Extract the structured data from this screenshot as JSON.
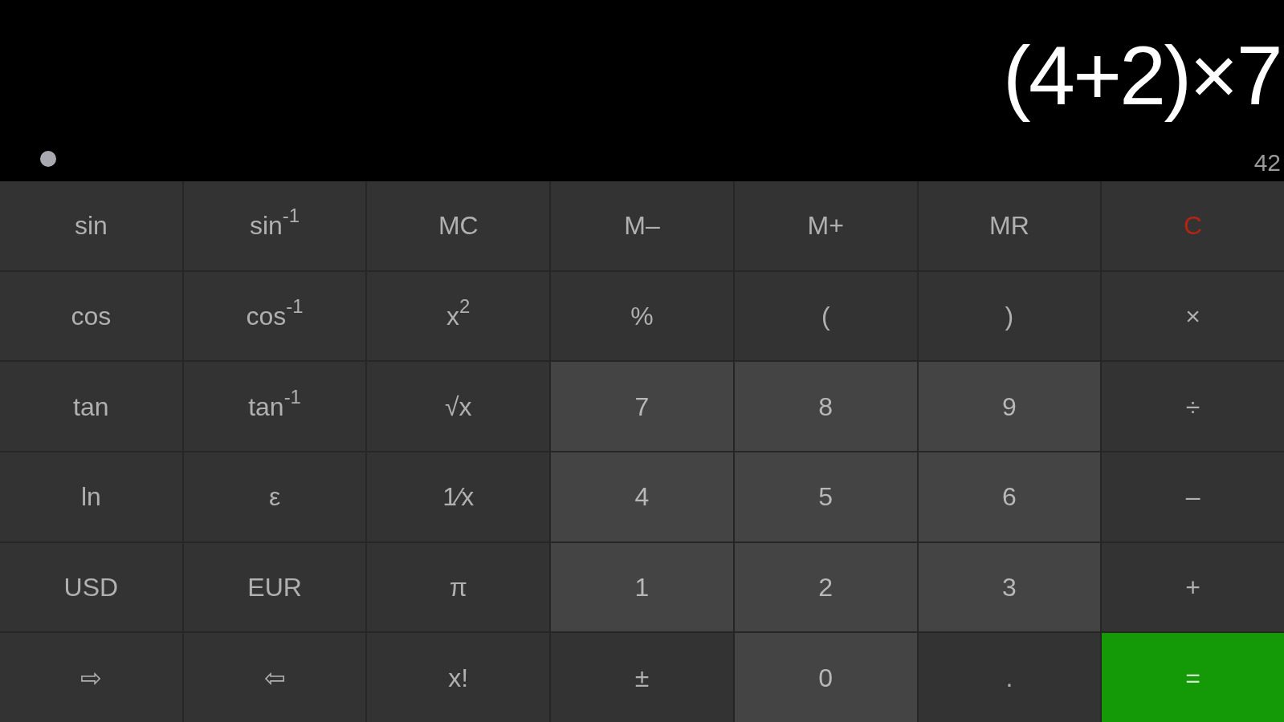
{
  "display": {
    "expression": "(4+2)×7",
    "result": "42"
  },
  "keys": [
    {
      "label": "sin",
      "kind": "func"
    },
    {
      "label": "sin$^{-1}$",
      "kind": "func"
    },
    {
      "label": "MC",
      "kind": "func"
    },
    {
      "label": "M–",
      "kind": "func"
    },
    {
      "label": "M+",
      "kind": "func"
    },
    {
      "label": "MR",
      "kind": "func"
    },
    {
      "label": "C",
      "kind": "clear"
    },
    {
      "label": "cos",
      "kind": "func"
    },
    {
      "label": "cos$^{-1}$",
      "kind": "func"
    },
    {
      "label": "x$^{2}$",
      "kind": "func"
    },
    {
      "label": "%",
      "kind": "func"
    },
    {
      "label": "(",
      "kind": "func"
    },
    {
      "label": ")",
      "kind": "func"
    },
    {
      "label": "×",
      "kind": "op"
    },
    {
      "label": "tan",
      "kind": "func"
    },
    {
      "label": "tan$^{-1}$",
      "kind": "func"
    },
    {
      "label": "√x",
      "kind": "func"
    },
    {
      "label": "7",
      "kind": "digit"
    },
    {
      "label": "8",
      "kind": "digit"
    },
    {
      "label": "9",
      "kind": "digit"
    },
    {
      "label": "÷",
      "kind": "op"
    },
    {
      "label": "ln",
      "kind": "func"
    },
    {
      "label": "ε",
      "kind": "func"
    },
    {
      "label": "1⁄x",
      "kind": "func"
    },
    {
      "label": "4",
      "kind": "digit"
    },
    {
      "label": "5",
      "kind": "digit"
    },
    {
      "label": "6",
      "kind": "digit"
    },
    {
      "label": "–",
      "kind": "op"
    },
    {
      "label": "USD",
      "kind": "func"
    },
    {
      "label": "EUR",
      "kind": "func"
    },
    {
      "label": "π",
      "kind": "func"
    },
    {
      "label": "1",
      "kind": "digit"
    },
    {
      "label": "2",
      "kind": "digit"
    },
    {
      "label": "3",
      "kind": "digit"
    },
    {
      "label": "+",
      "kind": "op"
    },
    {
      "label": "⇨",
      "kind": "func"
    },
    {
      "label": "⇦",
      "kind": "func"
    },
    {
      "label": "x!",
      "kind": "func"
    },
    {
      "label": "±",
      "kind": "func"
    },
    {
      "label": "0",
      "kind": "digit"
    },
    {
      "label": ".",
      "kind": "func"
    },
    {
      "label": "=",
      "kind": "equals"
    }
  ]
}
